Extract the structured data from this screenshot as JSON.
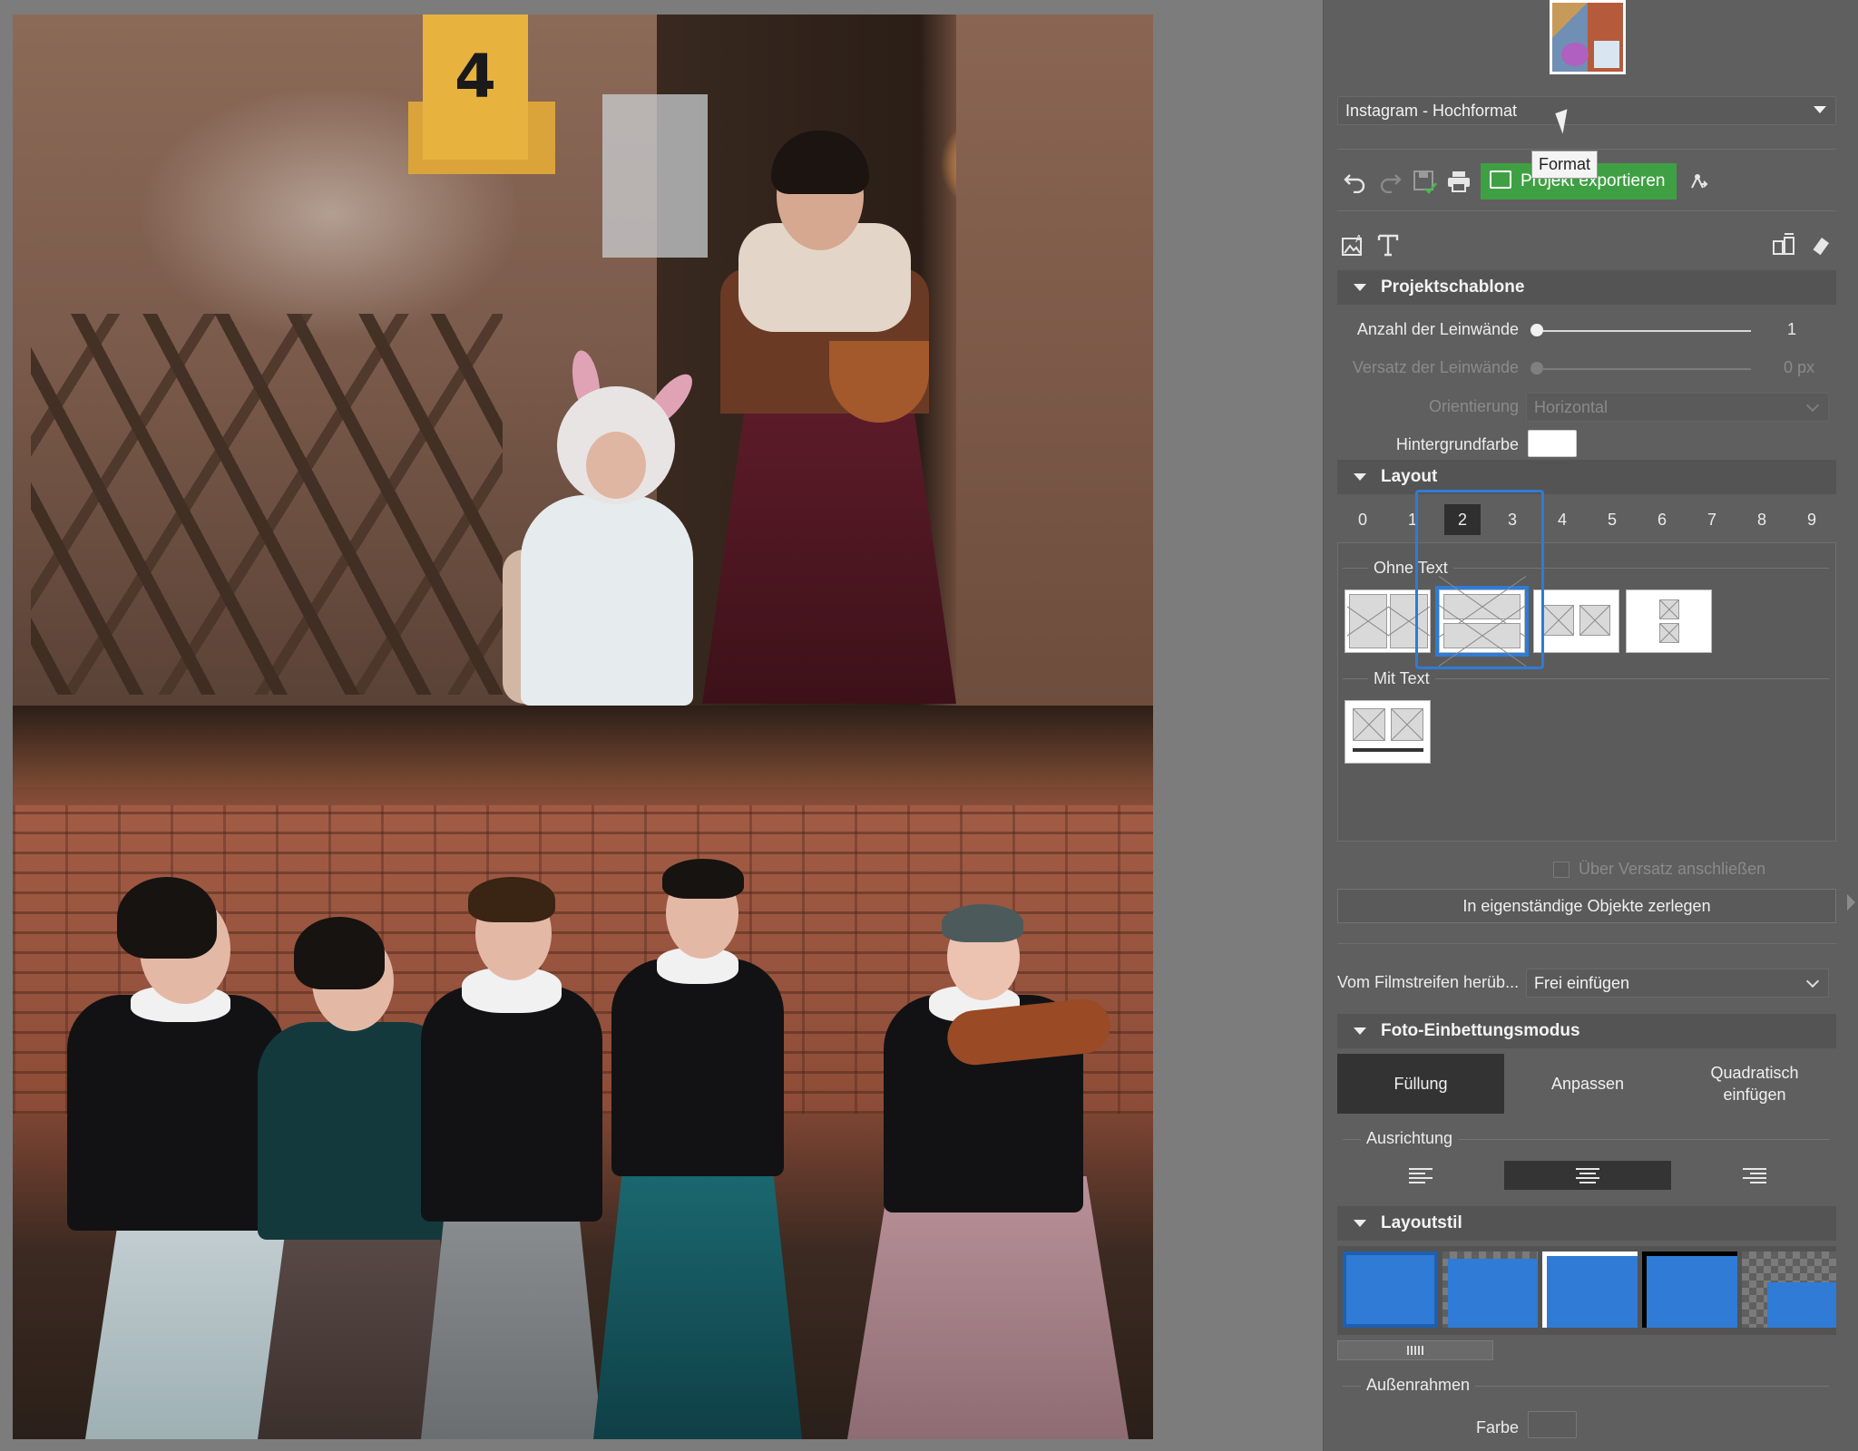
{
  "canvas": {
    "top_photo": {
      "sign_number": "4"
    },
    "bottom_photo": {}
  },
  "panel": {
    "format_select": {
      "value": "Instagram - Hochformat",
      "tooltip": "Format"
    },
    "toolbar": {
      "export_label": "Projekt exportieren",
      "icons": [
        "undo-icon",
        "redo-icon",
        "save-icon",
        "print-icon",
        "export-icon",
        "share-icon"
      ]
    },
    "tool_icons": [
      "image-text-icon",
      "text-icon",
      "ungroup-icon",
      "eraser-icon"
    ],
    "projektschablone": {
      "title": "Projektschablone",
      "anzahl_label": "Anzahl der Leinwände",
      "anzahl_value": "1",
      "versatz_label": "Versatz der Leinwände",
      "versatz_value": "0 px",
      "orientierung_label": "Orientierung",
      "orientierung_value": "Horizontal",
      "hintergrund_label": "Hintergrundfarbe",
      "hintergrund_color": "#ffffff"
    },
    "layout": {
      "title": "Layout",
      "numbers": [
        "0",
        "1",
        "2",
        "3",
        "4",
        "5",
        "6",
        "7",
        "8",
        "9"
      ],
      "selected": "2",
      "ohne_text_label": "Ohne Text",
      "mit_text_label": "Mit Text",
      "ueber_versatz_label": "Über Versatz anschließen",
      "zerlegen_label": "In eigenständige Objekte zerlegen"
    },
    "filmstreifen": {
      "label": "Vom Filmstreifen herüb...",
      "value": "Frei einfügen"
    },
    "einbettung": {
      "title": "Foto-Einbettungsmodus",
      "modes": [
        "Füllung",
        "Anpassen",
        "Quadratisch einfügen"
      ],
      "selected": "Füllung",
      "ausrichtung_label": "Ausrichtung"
    },
    "layoutstil": {
      "title": "Layoutstil",
      "accent": "#2f7bd6",
      "aussenrahmen_label": "Außenrahmen",
      "farbe_label": "Farbe"
    }
  }
}
